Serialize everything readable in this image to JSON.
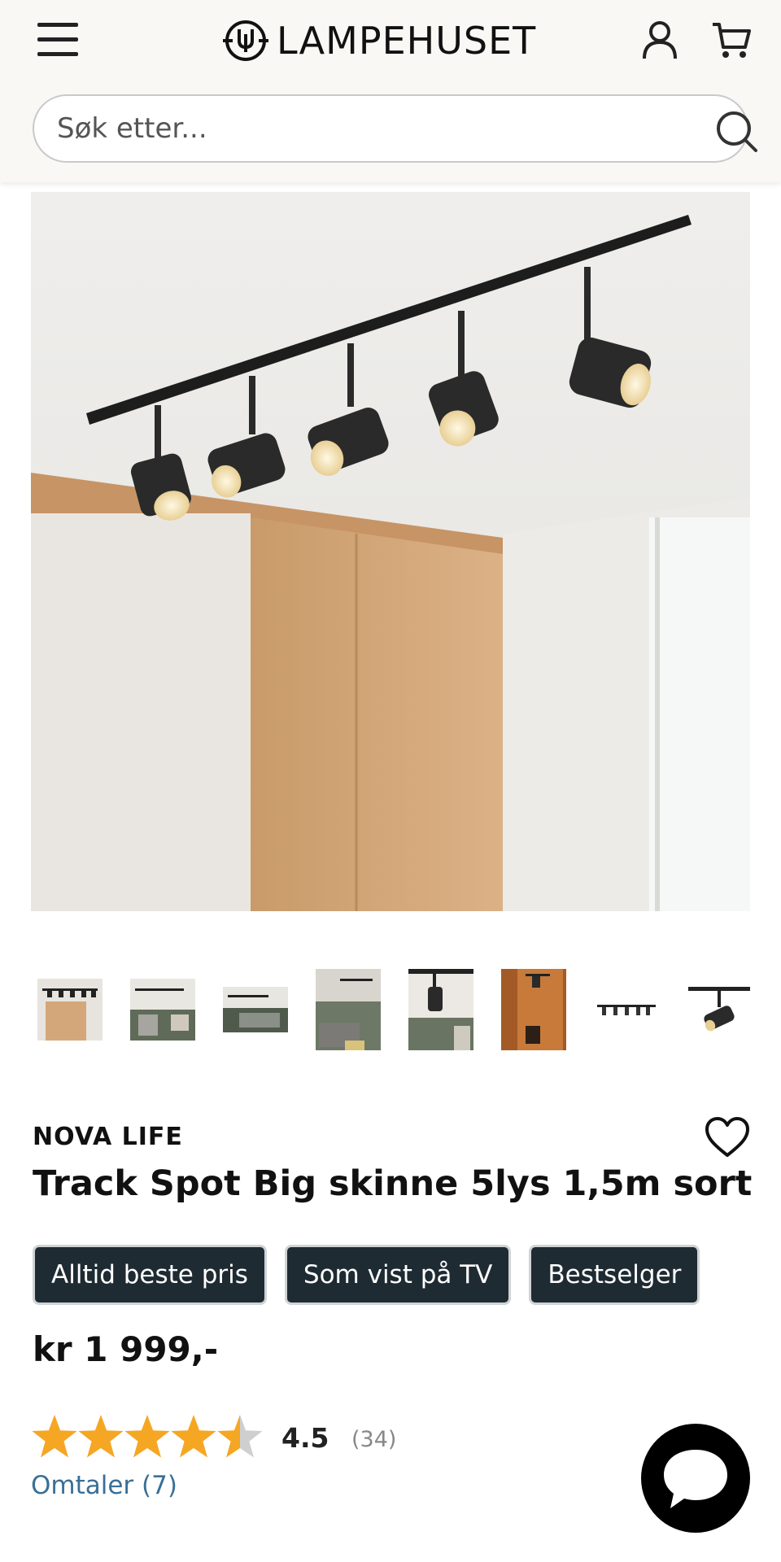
{
  "header": {
    "logo_text": "LAMPEHUSET",
    "menu_icon": "hamburger-menu-icon",
    "account_icon": "user-icon",
    "cart_icon": "shopping-cart-icon"
  },
  "search": {
    "placeholder": "Søk etter...",
    "value": "",
    "icon": "search-icon"
  },
  "gallery": {
    "thumbnail_count": 8
  },
  "product": {
    "brand": "NOVA LIFE",
    "title": "Track Spot Big skinne 5lys 1,5m sort",
    "badges": [
      "Alltid beste pris",
      "Som vist på TV",
      "Bestselger"
    ],
    "price": "kr 1 999,-",
    "rating": {
      "value": "4.5",
      "stars_filled": 4.5,
      "stars_max": 5,
      "count": "(34)",
      "star_color": "#f5a623"
    },
    "reviews_link": "Omtaler (7)",
    "favorite_icon": "heart-icon"
  },
  "chat": {
    "icon": "chat-bubble-icon"
  },
  "colors": {
    "header_bg": "#f9f8f4",
    "badge_bg": "#1f2b33",
    "link": "#3a6f96"
  }
}
